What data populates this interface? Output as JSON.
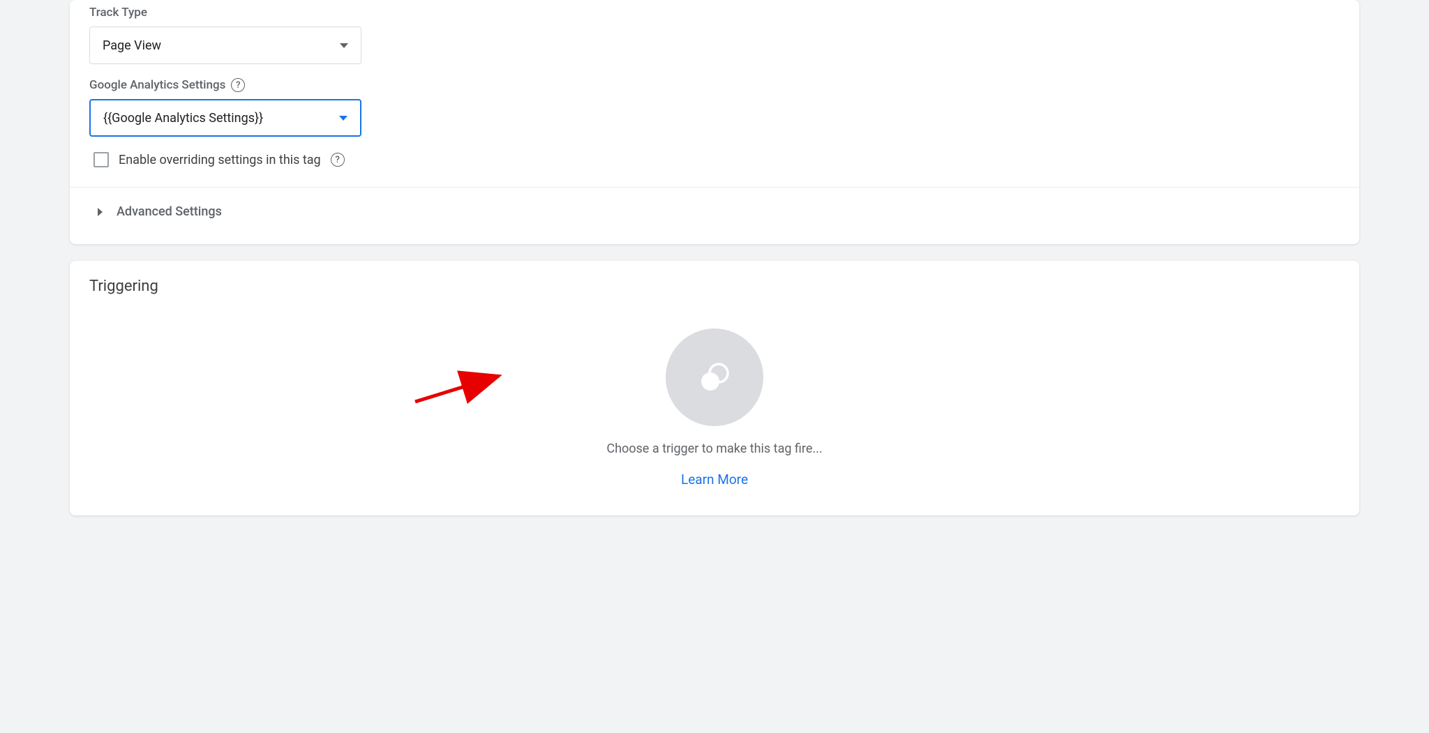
{
  "config": {
    "track_type_label": "Track Type",
    "track_type_value": "Page View",
    "ga_settings_label": "Google Analytics Settings",
    "ga_settings_value": "{{Google Analytics Settings}}",
    "override_label": "Enable overriding settings in this tag",
    "advanced_label": "Advanced Settings"
  },
  "triggering": {
    "title": "Triggering",
    "placeholder_text": "Choose a trigger to make this tag fire...",
    "learn_more": "Learn More"
  }
}
